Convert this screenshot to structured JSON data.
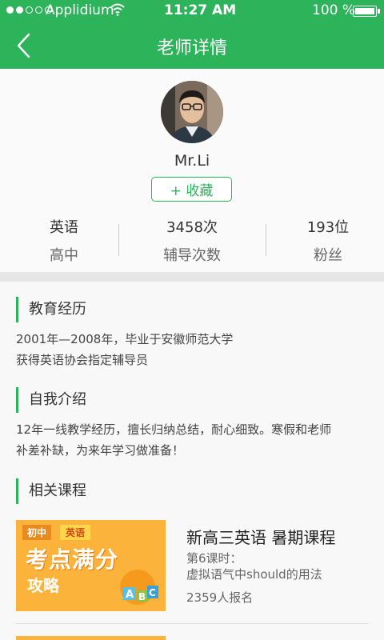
{
  "status": {
    "carrier": "Applidium",
    "time": "11:27 AM",
    "battery": "100 %",
    "signal_dots_filled": 2,
    "signal_dots_total": 5
  },
  "nav": {
    "title": "老师详情",
    "back_icon": "chevron-left-icon"
  },
  "profile": {
    "name": "Mr.Li",
    "favorite_label": "+ 收藏",
    "stats": [
      {
        "value": "英语",
        "label": "高中"
      },
      {
        "value": "3458次",
        "label": "辅导次数"
      },
      {
        "value": "193位",
        "label": "粉丝"
      }
    ]
  },
  "education": {
    "heading": "教育经历",
    "lines": [
      "2001年—2008年，毕业于安徽师范大学",
      "获得英语协会指定辅导员"
    ]
  },
  "intro": {
    "heading": "自我介绍",
    "lines": [
      "12年一线教学经历，擅长归纳总结，耐心细致。寒假和老师",
      "补差补缺，为来年学习做准备！"
    ]
  },
  "courses": {
    "heading": "相关课程",
    "items": [
      {
        "thumb_tag1": "初中",
        "thumb_tag2": "英语",
        "thumb_title": "考点满分",
        "thumb_subtitle": "攻略",
        "title": "新高三英语 暑期课程",
        "lesson_no": "第6课时：",
        "lesson_name": "虚拟语气中should的用法",
        "enrolled": "2359人报名"
      }
    ]
  },
  "colors": {
    "brand_green": "#2db35a",
    "thumb_orange": "#fcb33c"
  }
}
